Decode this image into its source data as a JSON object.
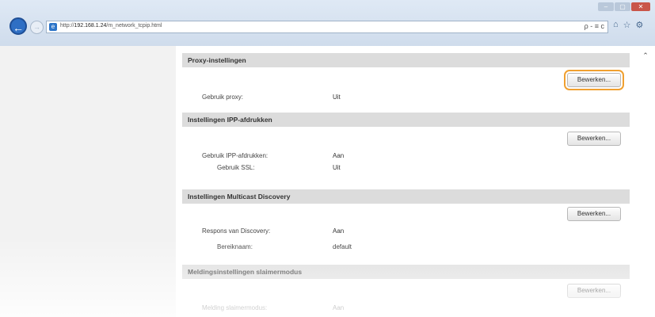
{
  "browser": {
    "url_prefix": "http://",
    "url_host": "192.168.1.24",
    "url_path": "/m_network_tcpip.html",
    "address_tools": "ρ - ≡ c",
    "window_buttons": [
      "–",
      "▢",
      "✕"
    ]
  },
  "sections": [
    {
      "title": "Proxy-instellingen",
      "edit_label": "Bewerken...",
      "rows": [
        {
          "label": "Gebruik proxy:",
          "value": "Uit"
        }
      ]
    },
    {
      "title": "Instellingen IPP-afdrukken",
      "edit_label": "Bewerken...",
      "rows": [
        {
          "label": "Gebruik IPP-afdrukken:",
          "value": "Aan"
        },
        {
          "label": "Gebruik SSL:",
          "value": "Uit"
        }
      ]
    },
    {
      "title": "Instellingen Multicast Discovery",
      "edit_label": "Bewerken...",
      "rows": [
        {
          "label": "Respons van Discovery:",
          "value": "Aan"
        },
        {
          "label": "Bereiknaam:",
          "value": "default"
        }
      ]
    },
    {
      "title": "Meldingsinstellingen slaimermodus",
      "edit_label": "Bewerken...",
      "rows": [
        {
          "label": "Melding slaimermodus:",
          "value": "Aan"
        }
      ]
    }
  ]
}
